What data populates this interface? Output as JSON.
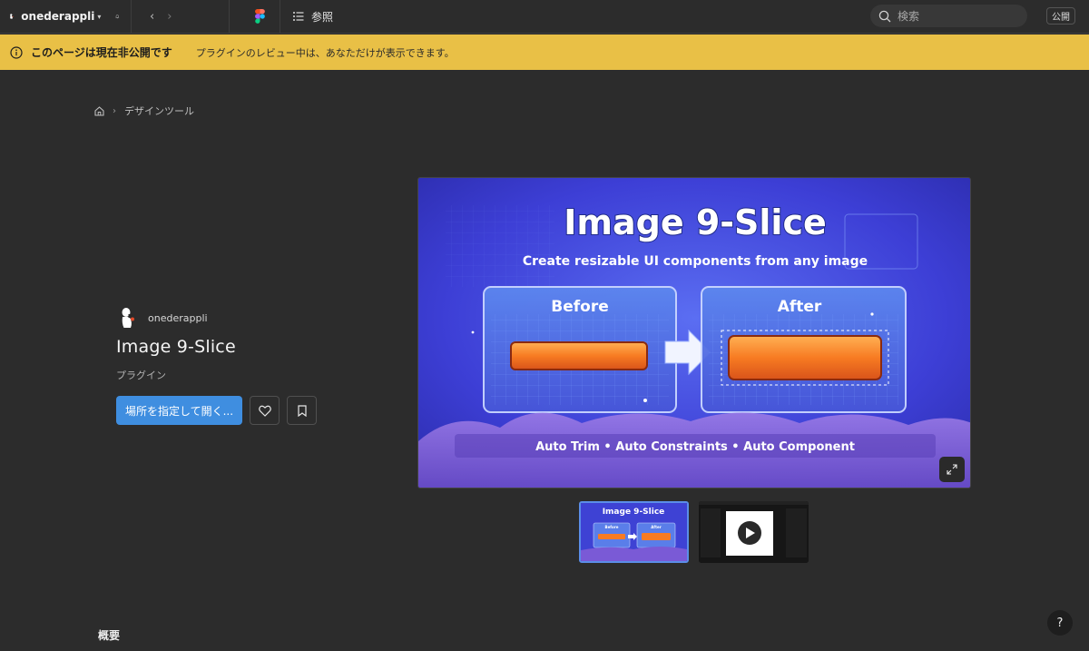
{
  "topbar": {
    "account_name": "onederappli",
    "browse_label": "参照",
    "search_placeholder": "検索",
    "publish_label": "公開"
  },
  "banner": {
    "title": "このページは現在非公開です",
    "message": "プラグインのレビュー中は、あなただけが表示できます。"
  },
  "breadcrumb": {
    "category": "デザインツール"
  },
  "plugin": {
    "author": "onederappli",
    "name": "Image 9-Slice",
    "kind": "プラグイン",
    "open_label": "場所を指定して開く..."
  },
  "hero": {
    "title": "Image 9-Slice",
    "subtitle": "Create resizable UI components from any image",
    "before_label": "Before",
    "after_label": "After",
    "features": "Auto Trim • Auto Constraints • Auto Component"
  },
  "thumbnails": [
    {
      "title": "Image 9-Slice",
      "before": "Before",
      "after": "After"
    },
    {
      "type": "video"
    }
  ],
  "section": {
    "overview": "概要"
  },
  "help_label": "?",
  "colors": {
    "banner": "#e9c046",
    "primary": "#3f8ee0",
    "background": "#2c2c2c"
  }
}
